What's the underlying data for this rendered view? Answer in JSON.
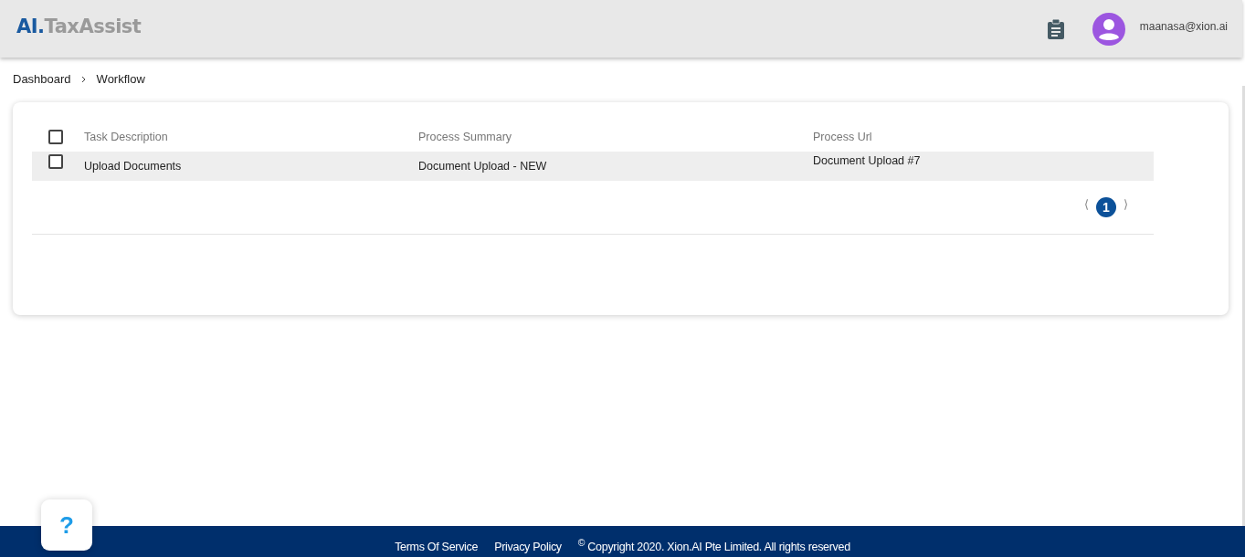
{
  "header": {
    "logo": {
      "prefix": "AI.",
      "name": "TaxAssist"
    },
    "user": "maanasa@xion.ai"
  },
  "breadcrumb": [
    "Dashboard",
    "Workflow"
  ],
  "table": {
    "header_checked": false,
    "columns": [
      "Task Description",
      "Process Summary",
      "Process Url"
    ],
    "rows": [
      {
        "checked": false,
        "cells": [
          "Upload Documents",
          "Document Upload - NEW",
          "Document Upload #7"
        ]
      }
    ]
  },
  "pagination": {
    "prev": "⟨",
    "next": "⟩",
    "pages": [
      {
        "label": "1",
        "selected": true
      }
    ]
  },
  "help": {
    "label": "?"
  },
  "footer": {
    "links": [
      "Terms Of Service",
      "Privacy Policy"
    ],
    "copyright": "$^{©}$ Copyright 2020. Xion.AI Pte Limited. All rights reserved"
  }
}
